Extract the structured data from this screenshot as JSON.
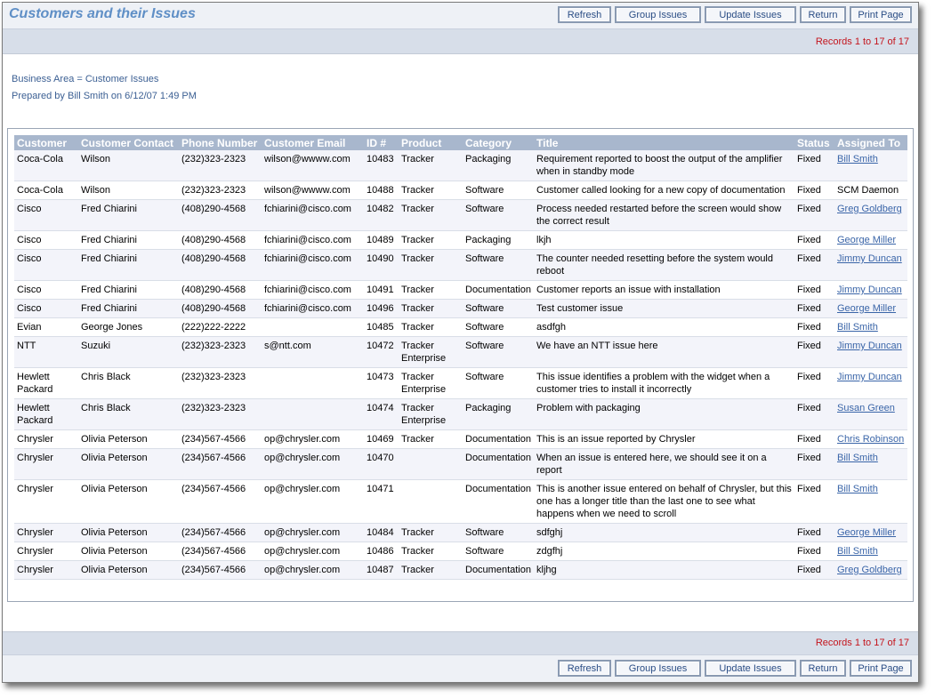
{
  "header": {
    "title": "Customers and their Issues",
    "buttons": [
      "Refresh",
      "Group Issues",
      "Update Issues",
      "Return",
      "Print Page"
    ]
  },
  "records": "Records 1 to 17 of 17",
  "info": {
    "business_area": "Business Area = Customer Issues",
    "prepared_by": "Prepared by Bill Smith on 6/12/07 1:49 PM"
  },
  "table": {
    "columns": [
      "Customer",
      "Customer Contact",
      "Phone Number",
      "Customer Email",
      "ID #",
      "Product",
      "Category",
      "Title",
      "Status",
      "Assigned To"
    ],
    "rows": [
      [
        "Coca-Cola",
        "Wilson",
        "(232)323-2323",
        "wilson@wwww.com",
        "10483",
        "Tracker",
        "Packaging",
        "Requirement reported to boost the output of the amplifier when in standby mode",
        "Fixed",
        "Bill Smith"
      ],
      [
        "Coca-Cola",
        "Wilson",
        "(232)323-2323",
        "wilson@wwww.com",
        "10488",
        "Tracker",
        "Software",
        "Customer called looking for a new copy of documentation",
        "Fixed",
        "SCM Daemon"
      ],
      [
        "Cisco",
        "Fred Chiarini",
        "(408)290-4568",
        "fchiarini@cisco.com",
        "10482",
        "Tracker",
        "Software",
        "Process needed restarted before the screen would show the correct result",
        "Fixed",
        "Greg Goldberg"
      ],
      [
        "Cisco",
        "Fred Chiarini",
        "(408)290-4568",
        "fchiarini@cisco.com",
        "10489",
        "Tracker",
        "Packaging",
        "lkjh",
        "Fixed",
        "George Miller"
      ],
      [
        "Cisco",
        "Fred Chiarini",
        "(408)290-4568",
        "fchiarini@cisco.com",
        "10490",
        "Tracker",
        "Software",
        "The counter needed resetting before the system would reboot",
        "Fixed",
        "Jimmy Duncan"
      ],
      [
        "Cisco",
        "Fred Chiarini",
        "(408)290-4568",
        "fchiarini@cisco.com",
        "10491",
        "Tracker",
        "Documentation",
        "Customer reports an issue with installation",
        "Fixed",
        "Jimmy Duncan"
      ],
      [
        "Cisco",
        "Fred Chiarini",
        "(408)290-4568",
        "fchiarini@cisco.com",
        "10496",
        "Tracker",
        "Software",
        "Test customer issue",
        "Fixed",
        "George Miller"
      ],
      [
        "Evian",
        "George Jones",
        "(222)222-2222",
        "",
        "10485",
        "Tracker",
        "Software",
        "asdfgh",
        "Fixed",
        "Bill Smith"
      ],
      [
        "NTT",
        "Suzuki",
        "(232)323-2323",
        "s@ntt.com",
        "10472",
        "Tracker Enterprise",
        "Software",
        "We have an NTT issue here",
        "Fixed",
        "Jimmy Duncan"
      ],
      [
        "Hewlett Packard",
        "Chris Black",
        "(232)323-2323",
        "",
        "10473",
        "Tracker Enterprise",
        "Software",
        "This issue identifies a problem with the widget when a customer tries to install it incorrectly",
        "Fixed",
        "Jimmy Duncan"
      ],
      [
        "Hewlett Packard",
        "Chris Black",
        "(232)323-2323",
        "",
        "10474",
        "Tracker Enterprise",
        "Packaging",
        "Problem with packaging",
        "Fixed",
        "Susan Green"
      ],
      [
        "Chrysler",
        "Olivia Peterson",
        "(234)567-4566",
        "op@chrysler.com",
        "10469",
        "Tracker",
        "Documentation",
        "This is an issue reported by Chrysler",
        "Fixed",
        "Chris Robinson"
      ],
      [
        "Chrysler",
        "Olivia Peterson",
        "(234)567-4566",
        "op@chrysler.com",
        "10470",
        "",
        "Documentation",
        "When an issue is entered here, we should see it on a report",
        "Fixed",
        "Bill Smith"
      ],
      [
        "Chrysler",
        "Olivia Peterson",
        "(234)567-4566",
        "op@chrysler.com",
        "10471",
        "",
        "Documentation",
        "This is another issue entered on behalf of Chrysler, but this one has a longer title than the last one to see what happens when we need to scroll",
        "Fixed",
        "Bill Smith"
      ],
      [
        "Chrysler",
        "Olivia Peterson",
        "(234)567-4566",
        "op@chrysler.com",
        "10484",
        "Tracker",
        "Software",
        "sdfghj",
        "Fixed",
        "George Miller"
      ],
      [
        "Chrysler",
        "Olivia Peterson",
        "(234)567-4566",
        "op@chrysler.com",
        "10486",
        "Tracker",
        "Software",
        "zdgfhj",
        "Fixed",
        "Bill Smith"
      ],
      [
        "Chrysler",
        "Olivia Peterson",
        "(234)567-4566",
        "op@chrysler.com",
        "10487",
        "Tracker",
        "Documentation",
        "kljhg",
        "Fixed",
        "Greg Goldberg"
      ]
    ],
    "linked_assignees": [
      "Bill Smith",
      "Greg Goldberg",
      "George Miller",
      "Jimmy Duncan",
      "Susan Green",
      "Chris Robinson"
    ]
  },
  "colors": {
    "title": "#5f8fc6",
    "header_bg": "#a8b7cd",
    "records_text": "#c4141c",
    "link": "#3a65a8"
  }
}
